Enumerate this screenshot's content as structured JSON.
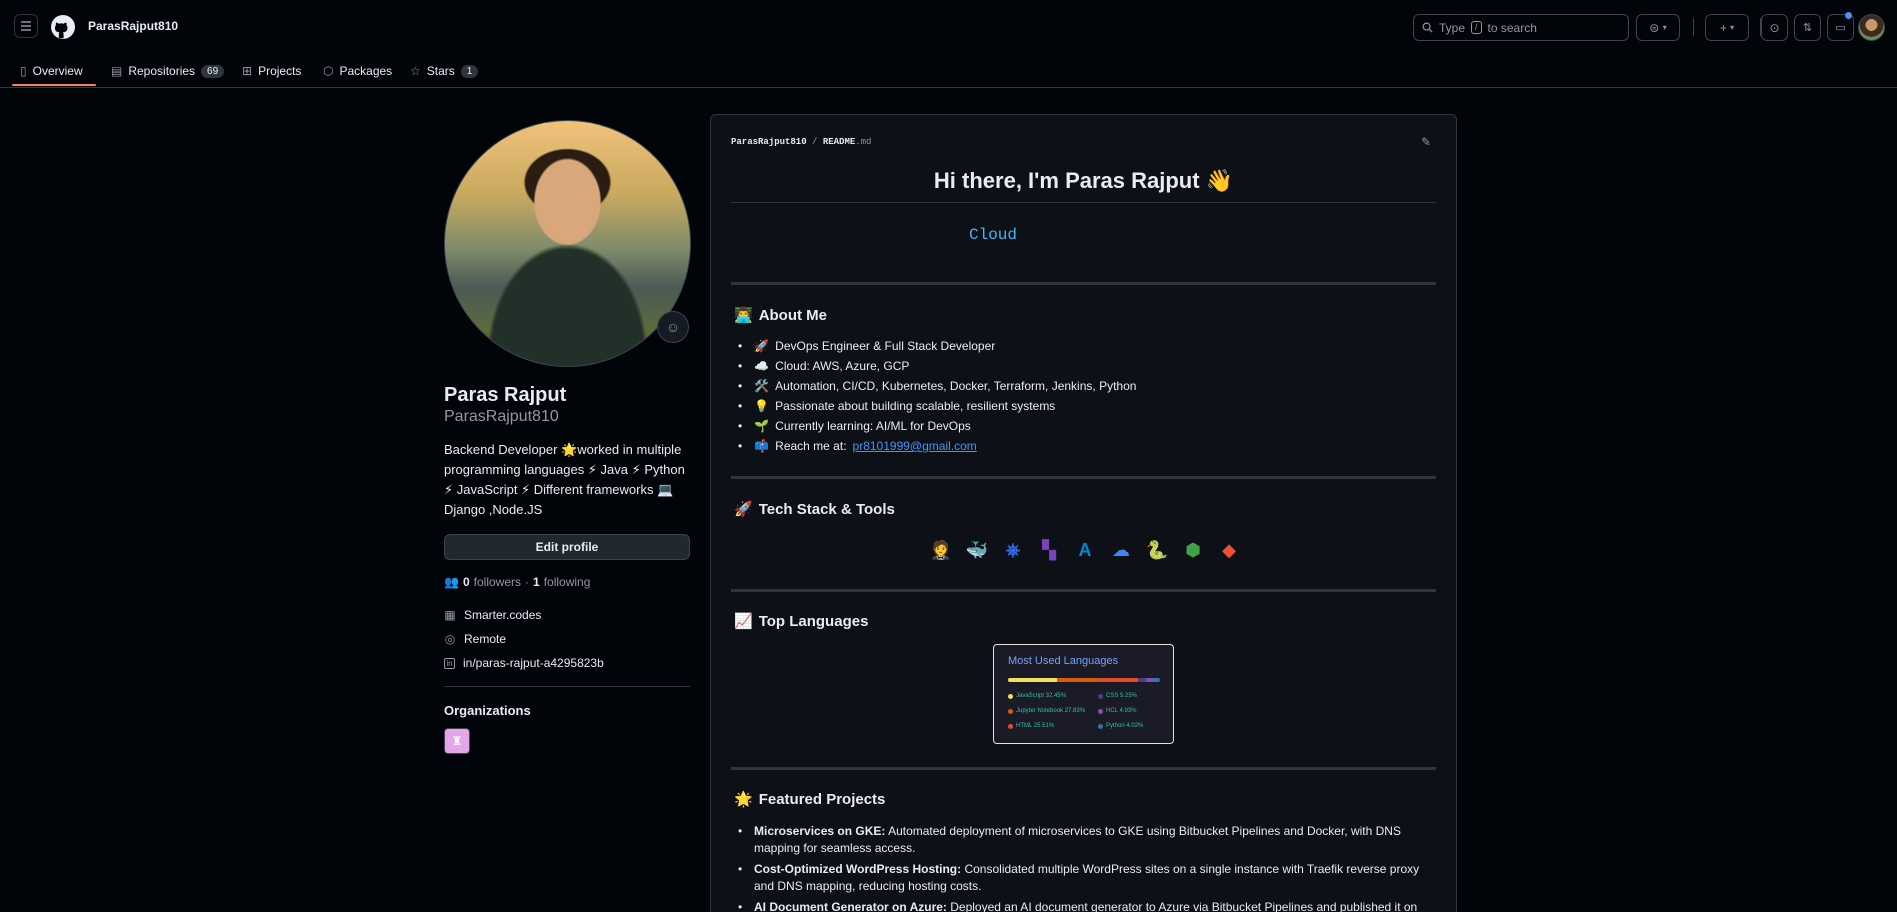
{
  "header": {
    "username": "ParasRajput810",
    "search_placeholder_pre": "Type",
    "search_key": "/",
    "search_placeholder_post": "to search"
  },
  "tabs": [
    {
      "label": "Overview",
      "icon": "book-icon"
    },
    {
      "label": "Repositories",
      "count": "69",
      "icon": "repo-icon"
    },
    {
      "label": "Projects",
      "icon": "table-icon"
    },
    {
      "label": "Packages",
      "icon": "package-icon"
    },
    {
      "label": "Stars",
      "count": "1",
      "icon": "star-icon"
    }
  ],
  "profile": {
    "name": "Paras Rajput",
    "login": "ParasRajput810",
    "bio": "Backend Developer 🌟worked in multiple programming languages ⚡ Java ⚡ Python ⚡ JavaScript ⚡ Different frameworks 💻 Django ,Node.JS",
    "edit_label": "Edit profile",
    "followers_count": "0",
    "followers_label": "followers",
    "dot": "·",
    "following_count": "1",
    "following_label": "following",
    "company": "Smarter.codes",
    "location": "Remote",
    "linkedin": "in/paras-rajput-a4295823b",
    "orgs_title": "Organizations"
  },
  "readme": {
    "path_owner": "ParasRajput810",
    "path_sep": "/",
    "path_file": "README",
    "path_ext": ".md",
    "h1": "Hi there, I'm Paras Rajput 👋",
    "typing": "Cloud",
    "about": {
      "title": "About Me",
      "emoji": "👨‍💻",
      "items": [
        {
          "emoji": "🚀",
          "text": "DevOps Engineer & Full Stack Developer"
        },
        {
          "emoji": "☁️",
          "text": "Cloud: AWS, Azure, GCP"
        },
        {
          "emoji": "🛠️",
          "text": "Automation, CI/CD, Kubernetes, Docker, Terraform, Jenkins, Python"
        },
        {
          "emoji": "💡",
          "text": "Passionate about building scalable, resilient systems"
        },
        {
          "emoji": "🌱",
          "text": "Currently learning: AI/ML for DevOps"
        },
        {
          "emoji": "📫",
          "text": "Reach me at: ",
          "link": "pr8101999@gmail.com"
        }
      ]
    },
    "tech": {
      "title": "Tech Stack & Tools",
      "emoji": "🚀",
      "icons": [
        {
          "name": "jenkins-icon",
          "glyph": "🤵",
          "color": "#d33833"
        },
        {
          "name": "docker-icon",
          "glyph": "🐳",
          "color": "#2496ed"
        },
        {
          "name": "kubernetes-icon",
          "glyph": "⎈",
          "color": "#326ce5"
        },
        {
          "name": "terraform-icon",
          "glyph": "▚",
          "color": "#7b42bc"
        },
        {
          "name": "azure-icon",
          "glyph": "A",
          "color": "#0089d6"
        },
        {
          "name": "gcp-icon",
          "glyph": "☁",
          "color": "#4285f4"
        },
        {
          "name": "python-icon",
          "glyph": "🐍",
          "color": "#3776ab"
        },
        {
          "name": "nodejs-icon",
          "glyph": "⬢",
          "color": "#43a047"
        },
        {
          "name": "git-icon",
          "glyph": "◆",
          "color": "#f05032"
        }
      ]
    },
    "langs": {
      "title": "Top Languages",
      "emoji": "📈",
      "card_title": "Most Used Languages",
      "items": [
        {
          "name": "JavaScript",
          "pct": "32.45%",
          "value": 32.45,
          "color": "#f1e05a"
        },
        {
          "name": "Jupyter Notebook",
          "pct": "27.83%",
          "value": 27.83,
          "color": "#da5b0b"
        },
        {
          "name": "HTML",
          "pct": "25.51%",
          "value": 25.51,
          "color": "#e34c26"
        },
        {
          "name": "CSS",
          "pct": "5.25%",
          "value": 5.25,
          "color": "#563d7c"
        },
        {
          "name": "HCL",
          "pct": "4.93%",
          "value": 4.93,
          "color": "#844fba"
        },
        {
          "name": "Python",
          "pct": "4.02%",
          "value": 4.02,
          "color": "#3572a5"
        }
      ]
    },
    "projects": {
      "title": "Featured Projects",
      "emoji": "🌟",
      "items": [
        {
          "bold": "Microservices on GKE:",
          "text": " Automated deployment of microservices to GKE using Bitbucket Pipelines and Docker, with DNS mapping for seamless access."
        },
        {
          "bold": "Cost-Optimized WordPress Hosting:",
          "text": " Consolidated multiple WordPress sites on a single instance with Traefik reverse proxy and DNS mapping, reducing hosting costs."
        },
        {
          "bold": "AI Document Generator on Azure:",
          "text": " Deployed an AI document generator to Azure via Bitbucket Pipelines and published it on Azure"
        }
      ]
    }
  }
}
